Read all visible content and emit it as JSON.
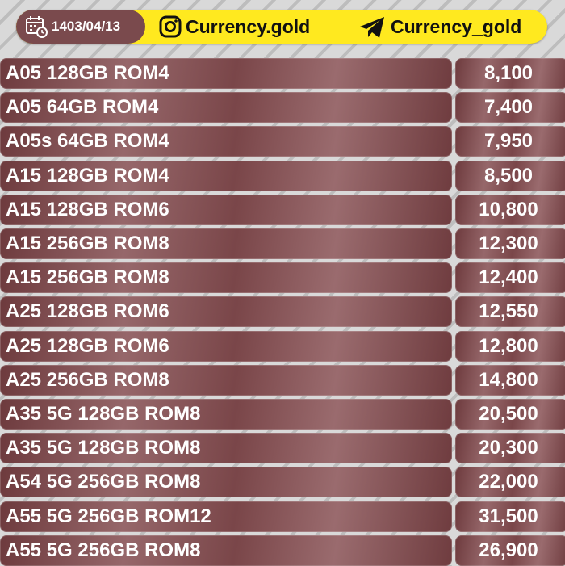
{
  "header": {
    "date": "1403/04/13",
    "instagram_handle": "Currency.gold",
    "telegram_handle": "Currency_gold",
    "colors": {
      "banner": "#ffe91f",
      "date_pill": "#7a4a4d",
      "row": "#7a4649"
    },
    "icons": {
      "date": "calendar-clock-icon",
      "instagram": "instagram-icon",
      "telegram": "telegram-icon"
    }
  },
  "rows": [
    {
      "model": "A05 128GB ROM4",
      "price": "8,100"
    },
    {
      "model": "A05 64GB ROM4",
      "price": "7,400"
    },
    {
      "model": "A05s 64GB ROM4",
      "price": "7,950"
    },
    {
      "model": "A15 128GB ROM4",
      "price": "8,500"
    },
    {
      "model": "A15 128GB ROM6",
      "price": "10,800"
    },
    {
      "model": "A15 256GB ROM8",
      "price": "12,300"
    },
    {
      "model": "A15 256GB ROM8",
      "price": "12,400"
    },
    {
      "model": "A25 128GB ROM6",
      "price": "12,550"
    },
    {
      "model": "A25 128GB ROM6",
      "price": "12,800"
    },
    {
      "model": "A25 256GB ROM8",
      "price": "14,800"
    },
    {
      "model": "A35 5G 128GB ROM8",
      "price": "20,500"
    },
    {
      "model": "A35 5G 128GB ROM8",
      "price": "20,300"
    },
    {
      "model": "A54 5G 256GB ROM8",
      "price": "22,000"
    },
    {
      "model": "A55 5G 256GB ROM12",
      "price": "31,500"
    },
    {
      "model": "A55 5G 256GB ROM8",
      "price": "26,900"
    }
  ]
}
